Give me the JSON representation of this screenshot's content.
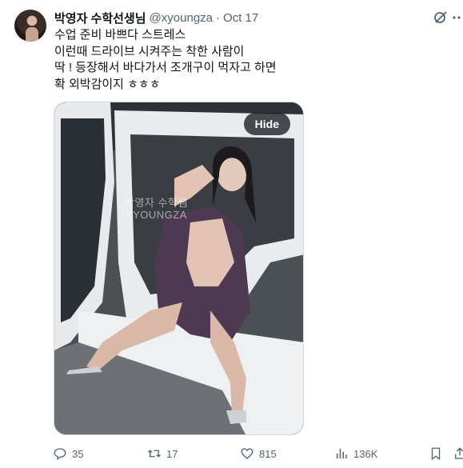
{
  "author": {
    "display_name": "박영자 수학선생님",
    "handle": "@xyoungza",
    "separator": "·",
    "date": "Oct 17"
  },
  "tweet": {
    "text": "수업 준비 바쁘다 스트레스\n이런때 드라이브 시켜주는 착한 사람이\n딱 ! 등장해서 바다가서 조개구이 먹자고 하면\n확 외박감이지 ㅎㅎㅎ"
  },
  "media": {
    "hide_label": "Hide",
    "watermark_line1": "박영자 수학쌤",
    "watermark_line2": "XYOUNGZA"
  },
  "actions": {
    "replies": "35",
    "retweets": "17",
    "likes": "815",
    "views": "136K"
  },
  "icons": {
    "reply": "reply-icon",
    "retweet": "retweet-icon",
    "like": "heart-icon",
    "views": "views-icon",
    "bookmark": "bookmark-icon",
    "share": "share-icon",
    "grok": "grok-icon",
    "more": "more-icon"
  },
  "colors": {
    "text": "#0f1419",
    "secondary": "#536471",
    "border": "#cfd9de"
  }
}
